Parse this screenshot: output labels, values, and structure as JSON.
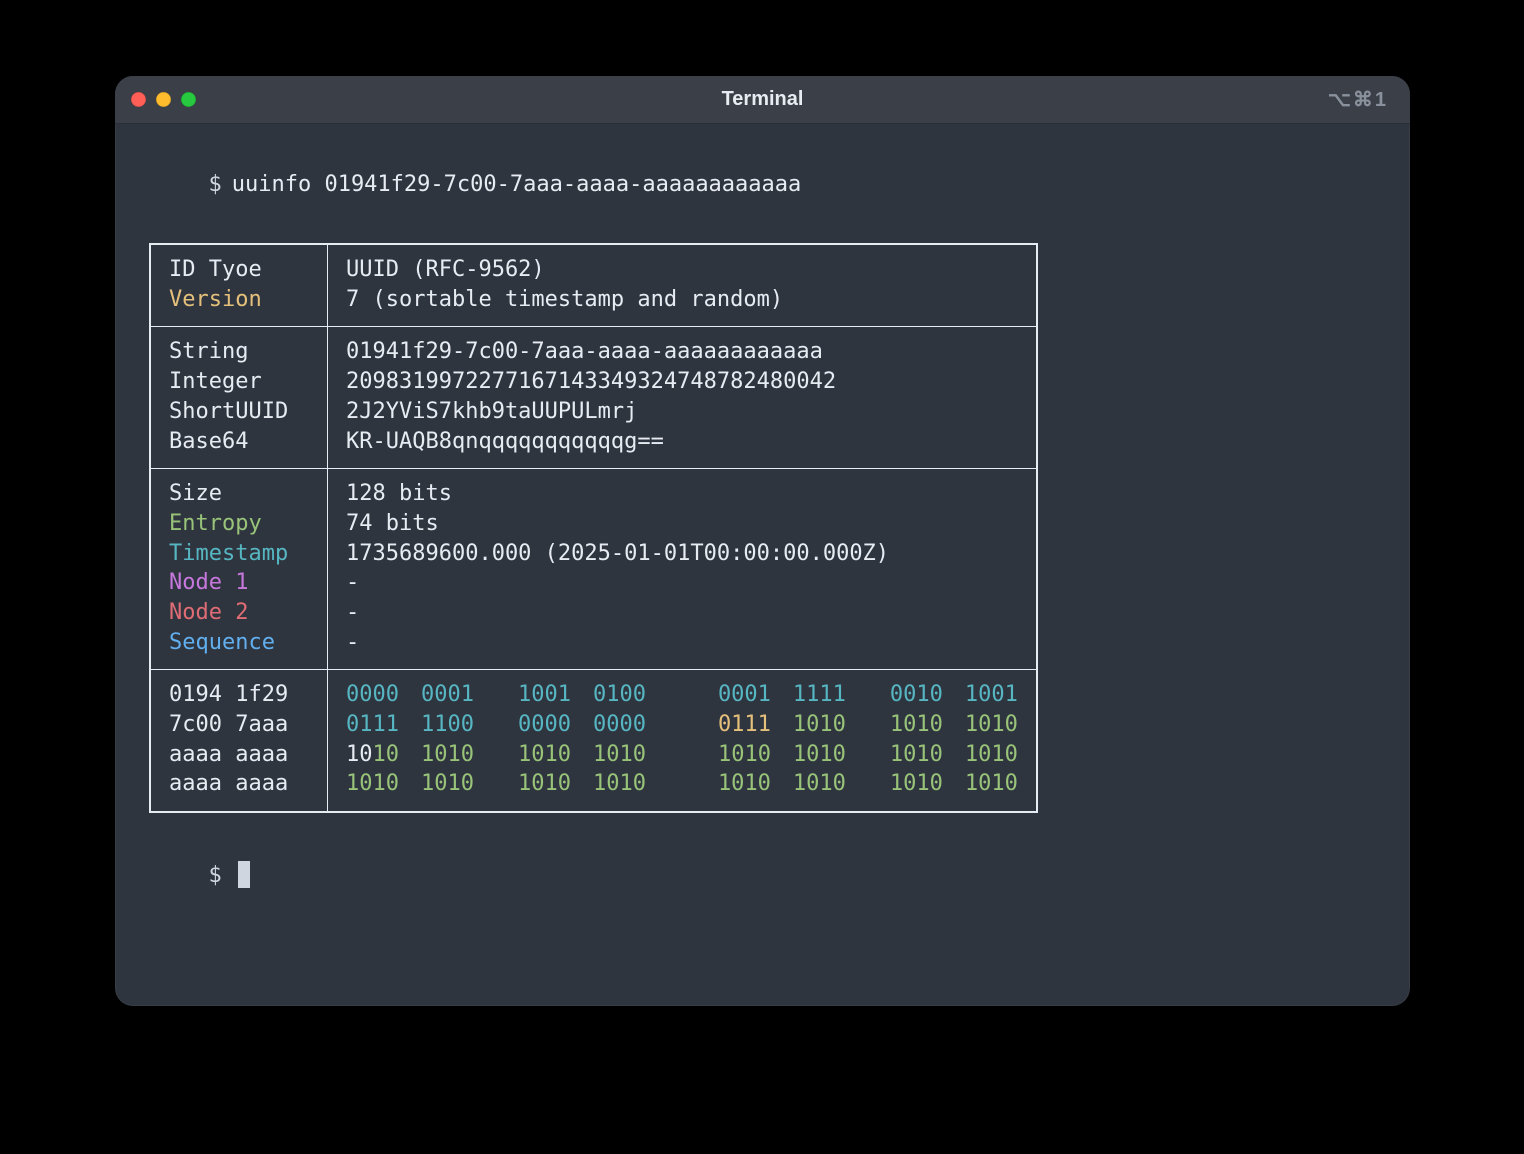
{
  "window": {
    "title": "Terminal",
    "shortcut": "⌥⌘1"
  },
  "prompt": {
    "symbol": "$",
    "command": "uuinfo 01941f29-7c00-7aaa-aaaa-aaaaaaaaaaaa"
  },
  "sections": {
    "header": {
      "labels": {
        "id_type": "ID Tyoe",
        "version": "Version"
      },
      "label_colors": {
        "id_type": "c-default",
        "version": "c-yellow"
      },
      "values": {
        "id_type": "UUID (RFC-9562)",
        "version": "7 (sortable timestamp and random)"
      }
    },
    "encodings": {
      "labels": {
        "string": "String",
        "integer": "Integer",
        "shortuuid": "ShortUUID",
        "base64": "Base64"
      },
      "label_colors": {
        "string": "c-default",
        "integer": "c-default",
        "shortuuid": "c-default",
        "base64": "c-default"
      },
      "values": {
        "string": "01941f29-7c00-7aaa-aaaa-aaaaaaaaaaaa",
        "integer": "2098319972277167143349324748782480042",
        "shortuuid": "2J2YViS7khb9taUUPULmrj",
        "base64": "KR-UAQB8qnqqqqqqqqqqqg=="
      }
    },
    "details": {
      "labels": {
        "size": "Size",
        "entropy": "Entropy",
        "timestamp": "Timestamp",
        "node1": "Node 1",
        "node2": "Node 2",
        "sequence": "Sequence"
      },
      "label_colors": {
        "size": "c-default",
        "entropy": "c-green",
        "timestamp": "c-cyan",
        "node1": "c-purple",
        "node2": "c-red",
        "sequence": "c-blue"
      },
      "values": {
        "size": "128 bits",
        "entropy": "74 bits",
        "timestamp": "1735689600.000 (2025-01-01T00:00:00.000Z)",
        "node1": "-",
        "node2": "-",
        "sequence": "-"
      }
    },
    "binary": {
      "hex_rows": [
        "0194 1f29",
        "7c00 7aaa",
        "aaaa aaaa",
        "aaaa aaaa"
      ],
      "rows": [
        {
          "groups": [
            "0000",
            "0001",
            "1001",
            "0100",
            "0001",
            "1111",
            "0010",
            "1001"
          ],
          "colors": [
            "c-cyan",
            "c-cyan",
            "c-cyan",
            "c-cyan",
            "c-cyan",
            "c-cyan",
            "c-cyan",
            "c-cyan"
          ]
        },
        {
          "groups": [
            "0111",
            "1100",
            "0000",
            "0000",
            "0111",
            "1010",
            "1010",
            "1010"
          ],
          "colors": [
            "c-cyan",
            "c-cyan",
            "c-cyan",
            "c-cyan",
            "hl-y",
            "c-green",
            "c-green",
            "c-green"
          ]
        },
        {
          "groups": [
            "1010",
            "1010",
            "1010",
            "1010",
            "1010",
            "1010",
            "1010",
            "1010"
          ],
          "colors": [
            "row3-variant",
            "c-green",
            "c-green",
            "c-green",
            "c-green",
            "c-green",
            "c-green",
            "c-green"
          ]
        },
        {
          "groups": [
            "1010",
            "1010",
            "1010",
            "1010",
            "1010",
            "1010",
            "1010",
            "1010"
          ],
          "colors": [
            "c-green",
            "c-green",
            "c-green",
            "c-green",
            "c-green",
            "c-green",
            "c-green",
            "c-green"
          ]
        }
      ],
      "variant_bits_white": "10",
      "variant_bits_rest": "10",
      "variant_rest_color": "c-green"
    }
  },
  "colors": {
    "yellow": "#e5c07b",
    "green": "#98c379",
    "cyan": "#56b6c2",
    "purple": "#c678dd",
    "red": "#e06c75",
    "blue": "#61afef"
  }
}
